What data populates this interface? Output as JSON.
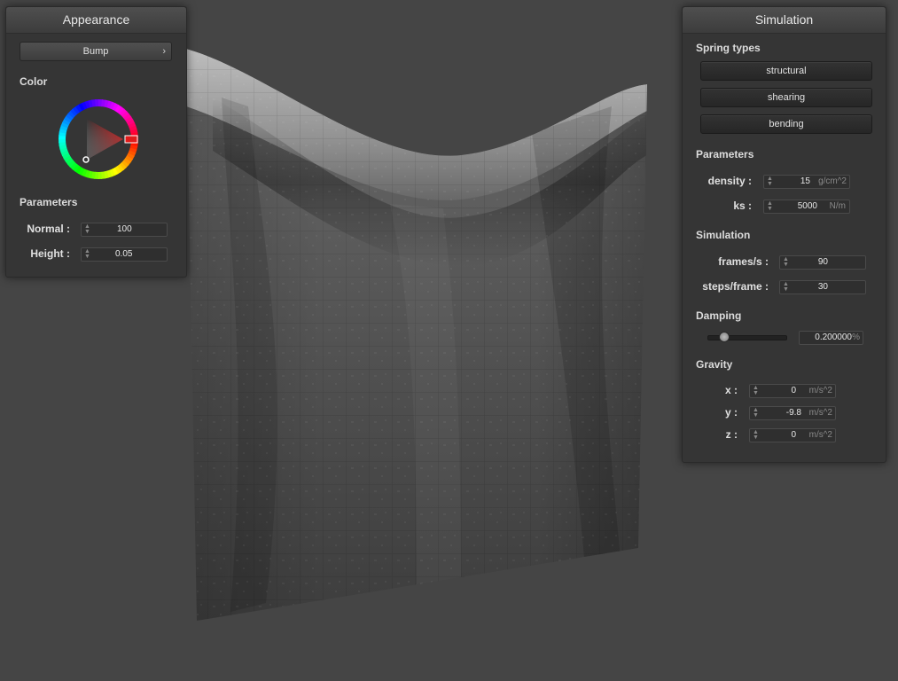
{
  "appearance": {
    "title": "Appearance",
    "shading_mode": "Bump",
    "color_label": "Color",
    "parameters_label": "Parameters",
    "normal_label": "Normal :",
    "normal_value": "100",
    "height_label": "Height :",
    "height_value": "0.05",
    "selected_color": "#e01b1b"
  },
  "simulation": {
    "title": "Simulation",
    "spring_types_label": "Spring types",
    "springs": [
      "structural",
      "shearing",
      "bending"
    ],
    "parameters_label": "Parameters",
    "density_label": "density :",
    "density_value": "15",
    "density_unit": "g/cm^2",
    "ks_label": "ks :",
    "ks_value": "5000",
    "ks_unit": "N/m",
    "simulation_label": "Simulation",
    "fps_label": "frames/s :",
    "fps_value": "90",
    "steps_label": "steps/frame :",
    "steps_value": "30",
    "damping_label": "Damping",
    "damping_value": "0.200000",
    "damping_unit": "%",
    "damping_fraction": 0.2,
    "gravity_label": "Gravity",
    "gx_label": "x :",
    "gx_value": "0",
    "gy_label": "y :",
    "gy_value": "-9.8",
    "gz_label": "z :",
    "gz_value": "0",
    "gravity_unit": "m/s^2"
  }
}
